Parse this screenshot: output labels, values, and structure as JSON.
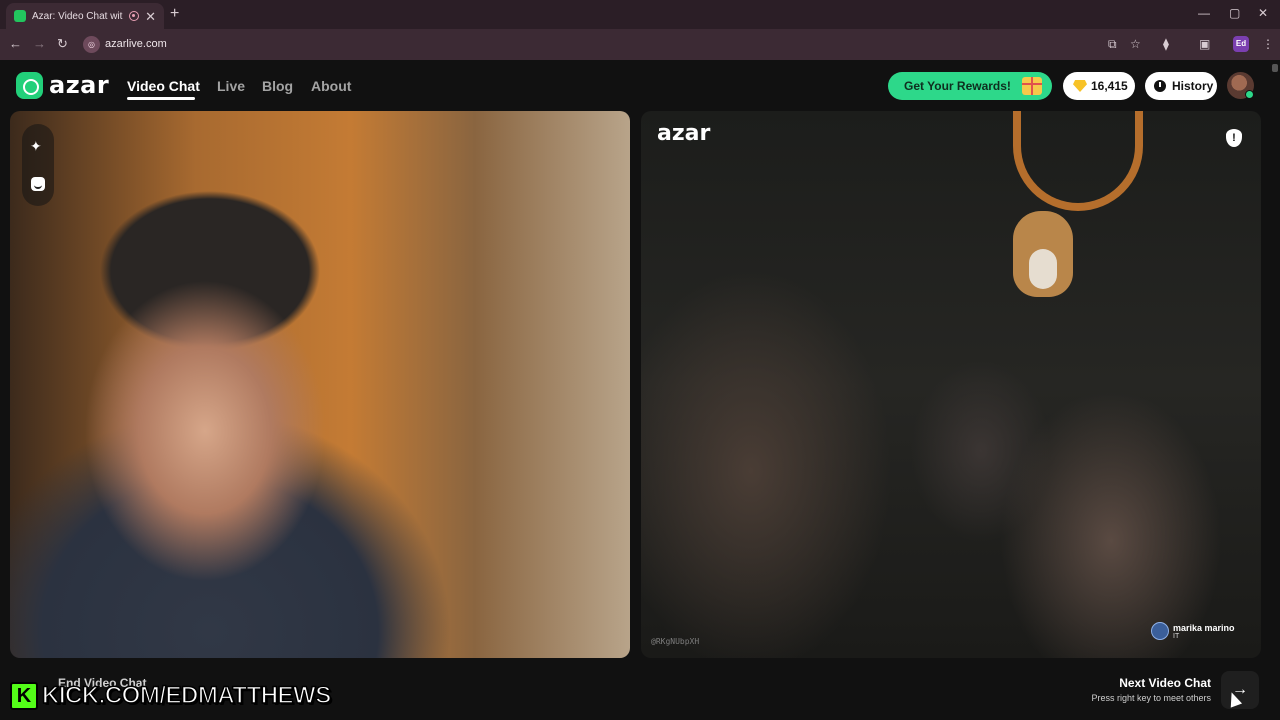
{
  "browser": {
    "tab_title": "Azar: Video Chat with New",
    "tab_close": "✕",
    "new_tab": "+",
    "url": "azarlive.com",
    "profile_initials": "Ed",
    "window_controls": [
      "—",
      "▢",
      "✕"
    ],
    "nav": [
      "←",
      "→",
      "↻"
    ]
  },
  "header": {
    "logo_text": "azar",
    "nav_links": [
      "Video Chat",
      "Live",
      "Blog",
      "About"
    ],
    "active_nav": "Video Chat",
    "rewards_label": "Get Your Rewards!",
    "gems_count": "16,415",
    "history_label": "History"
  },
  "left_video": {
    "tools": [
      "sparkle-icon",
      "face-filter-icon"
    ],
    "sparkle_glyph": "✦"
  },
  "right_video": {
    "watermark": "azar",
    "report_glyph": "!",
    "session_id": "@RKgNUbpXH",
    "peer_name": "marika marino",
    "peer_country": "IT"
  },
  "footer": {
    "end_chat_label": "End Video Chat",
    "next_title": "Next Video Chat",
    "next_subtitle": "Press right key to meet others",
    "next_arrow": "→",
    "overlay_k": "K",
    "overlay_text": "KICK.COM/EDMATTHEWS"
  },
  "colors": {
    "accent_green": "#2dd88a",
    "kick_green": "#53fc18",
    "browser_frame": "#3c2a34"
  }
}
